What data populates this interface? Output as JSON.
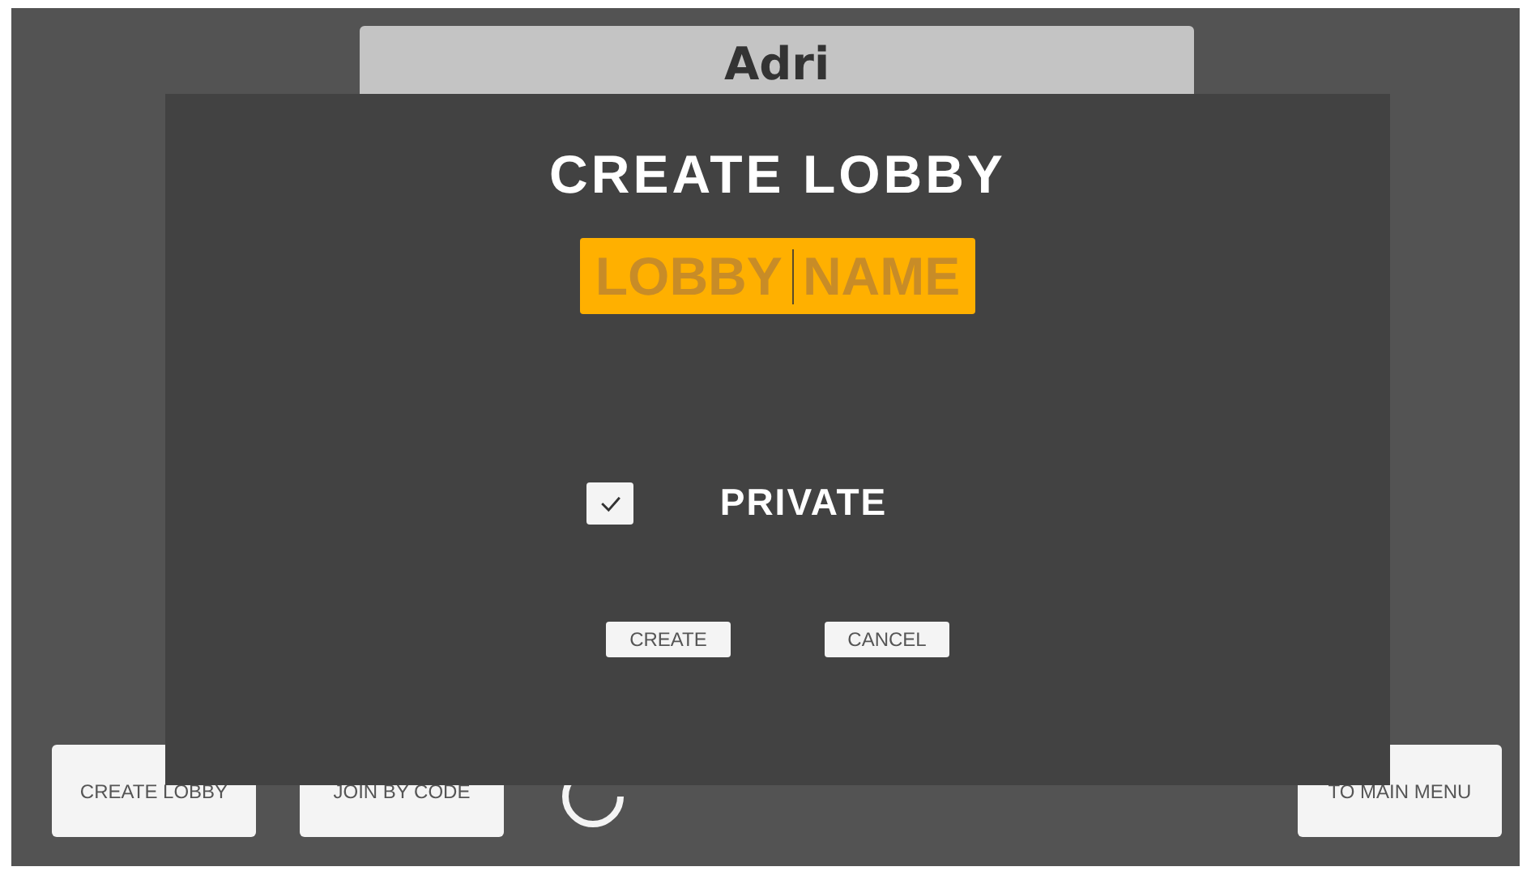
{
  "name_panel": {
    "name": "Adri"
  },
  "menu_buttons": [
    {
      "label": "CREATE LOBBY",
      "kind": "left"
    },
    {
      "label": "JOIN BY CODE",
      "kind": "left"
    },
    {
      "label": "TO MAIN MENU",
      "kind": "right"
    }
  ],
  "dialog": {
    "title": "CREATE LOBBY",
    "name_field": {
      "placeholder": "LOBBY NAME",
      "focused": true
    },
    "private": {
      "label": "PRIVATE",
      "checked": true
    },
    "buttons": [
      "CREATE",
      "CANCEL"
    ]
  }
}
